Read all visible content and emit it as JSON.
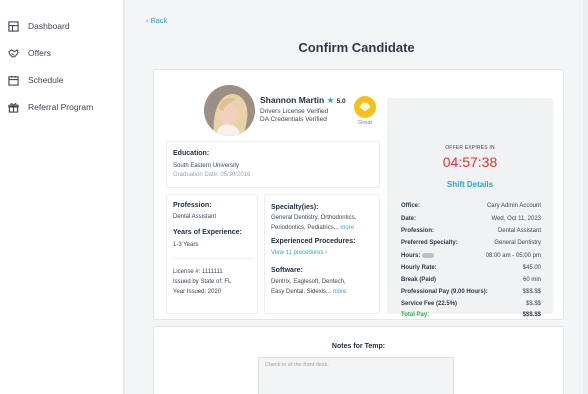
{
  "sidebar": {
    "items": [
      {
        "label": "Dashboard",
        "icon": "dashboard-icon"
      },
      {
        "label": "Offers",
        "icon": "handshake-icon"
      },
      {
        "label": "Schedule",
        "icon": "calendar-icon"
      },
      {
        "label": "Referral Program",
        "icon": "gift-icon"
      }
    ]
  },
  "header": {
    "back_label": "Back",
    "title": "Confirm Candidate"
  },
  "candidate": {
    "name": "Shannon Martin",
    "rating": "5.0",
    "verified_1": "Drivers License Verified",
    "verified_2": "DA Credentials Verified",
    "badge_label": "Great",
    "education_title": "Education:",
    "school": "South Eastern University",
    "graduation": "Graduation Date: 05/30/2016",
    "profession_title": "Profession:",
    "profession": "Dental Assistant",
    "experience_title": "Years of Experience:",
    "experience": "1-3 Years",
    "license": "License #: 1111111",
    "issued_state": "Issued by State of: FL",
    "year_issued": "Year Issued: 2020",
    "specialty_title": "Specialty(ies):",
    "specialty_1": "General Dentistry, Orthodontics,",
    "specialty_2": "Periodontics, Pediatrics...",
    "more_label": "more",
    "procedures_title": "Experienced Procedures:",
    "procedures_link": "View 11 procedures",
    "software_title": "Software:",
    "software_1": "Dentrix, Eaglesoft, Dentech,",
    "software_2": "Easy Dental, Sidexis..."
  },
  "shift": {
    "expires_label": "OFFER EXPIRES IN",
    "timer": "04:57:38",
    "title": "Shift Details",
    "rows": [
      {
        "key": "Office:",
        "value": "Cary Admin Account"
      },
      {
        "key": "Date:",
        "value": "Wed, Oct 11, 2023"
      },
      {
        "key": "Profession:",
        "value": "Dental Assistant"
      },
      {
        "key": "Preferred Specialty:",
        "value": "General Dentistry"
      },
      {
        "key": "Hours:",
        "value": "08:00 am - 05:00 pm"
      },
      {
        "key": "Hourly Rate:",
        "value": "$45.00"
      },
      {
        "key": "Break (Paid)",
        "value": "60 min"
      },
      {
        "key": "Professional Pay (9.00 Hours):",
        "value": "$$$.$$"
      },
      {
        "key": "Service Fee (22.5%)",
        "value": "$$.$$"
      },
      {
        "key": "Total Pay:",
        "value": "$$$.$$"
      }
    ]
  },
  "notes": {
    "title": "Notes for Temp:",
    "placeholder": "Check in at the front desk."
  },
  "colors": {
    "accent": "#2ea6c6",
    "timer": "#e2342b",
    "total": "#2fa84f",
    "badge": "#f3c21a"
  }
}
